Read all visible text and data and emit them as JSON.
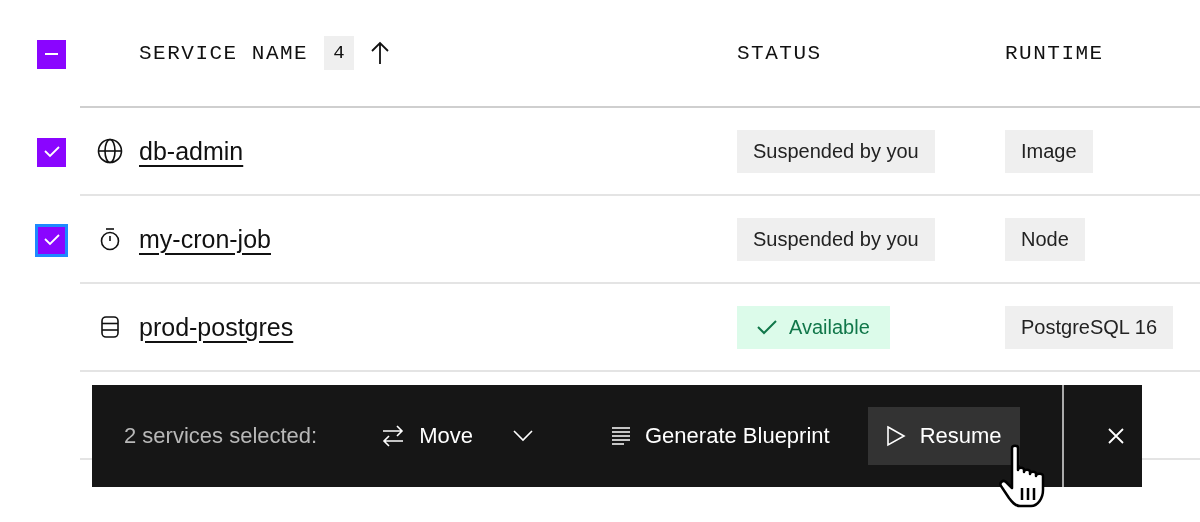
{
  "header": {
    "indeterminate": true,
    "columns": [
      {
        "label": "SERVICE NAME",
        "count": "4",
        "sort_ascending": true
      },
      {
        "label": "STATUS"
      },
      {
        "label": "RUNTIME"
      }
    ]
  },
  "rows": [
    {
      "selected": true,
      "focused": false,
      "kind": "globe",
      "name": "db-admin",
      "status": {
        "kind": "neutral",
        "label": "Suspended by you"
      },
      "runtime": "Image"
    },
    {
      "selected": true,
      "focused": true,
      "kind": "timer",
      "name": "my-cron-job",
      "status": {
        "kind": "neutral",
        "label": "Suspended by you"
      },
      "runtime": "Node"
    },
    {
      "selected": false,
      "focused": false,
      "kind": "database",
      "name": "prod-postgres",
      "status": {
        "kind": "success",
        "label": "Available"
      },
      "runtime": "PostgreSQL 16"
    }
  ],
  "action_bar": {
    "summary": "2 services selected:",
    "actions": [
      {
        "kind": "move",
        "label": "Move",
        "highlighted": false
      },
      {
        "kind": "blueprint",
        "label": "Generate Blueprint",
        "highlighted": false
      },
      {
        "kind": "resume",
        "label": "Resume",
        "highlighted": true
      }
    ]
  }
}
